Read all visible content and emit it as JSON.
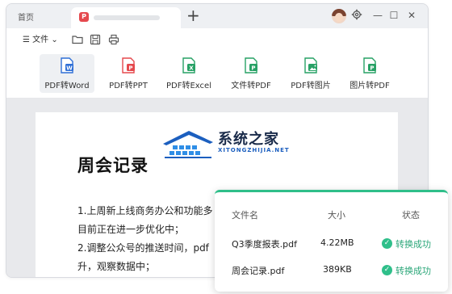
{
  "titlebar": {
    "home_tab": "首页",
    "active_tab_badge": "P",
    "new_tab_symbol": "+",
    "minimize_symbol": "—",
    "maximize_symbol": "☐",
    "close_symbol": "✕"
  },
  "menubar": {
    "menu_icon": "☰",
    "file_label": "文件",
    "file_chevron": "⌄"
  },
  "toolbar": {
    "items": [
      {
        "label": "PDF转Word",
        "icon": "word-icon",
        "color": "#2f6fd6",
        "letter": "W"
      },
      {
        "label": "PDF转PPT",
        "icon": "ppt-icon",
        "color": "#e5484d",
        "letter": "P"
      },
      {
        "label": "PDF转Excel",
        "icon": "excel-icon",
        "color": "#27a165",
        "letter": "X"
      },
      {
        "label": "文件转PDF",
        "icon": "pdf-icon",
        "color": "#27a165",
        "letter": "P"
      },
      {
        "label": "PDF转图片",
        "icon": "image-icon",
        "color": "#27a165",
        "letter": ""
      },
      {
        "label": "图片转PDF",
        "icon": "pdf-icon",
        "color": "#27a165",
        "letter": "P"
      }
    ]
  },
  "document": {
    "title": "周会记录",
    "lines": [
      "1.上周新上线商务办公和功能多",
      "目前正在进一步优化中；",
      "2.调整公众号的推送时间，pdf",
      "升，观察数据中；"
    ]
  },
  "watermark": {
    "name": "系统之家",
    "url": "XITONGZHIJIA.NET"
  },
  "conversion": {
    "headers": {
      "name": "文件名",
      "size": "大小",
      "status": "状态"
    },
    "rows": [
      {
        "name": "Q3季度报表.pdf",
        "size": "4.22MB",
        "status": "转换成功"
      },
      {
        "name": "周会记录.pdf",
        "size": "389KB",
        "status": "转换成功"
      }
    ],
    "success_color": "#2fbf8a"
  }
}
